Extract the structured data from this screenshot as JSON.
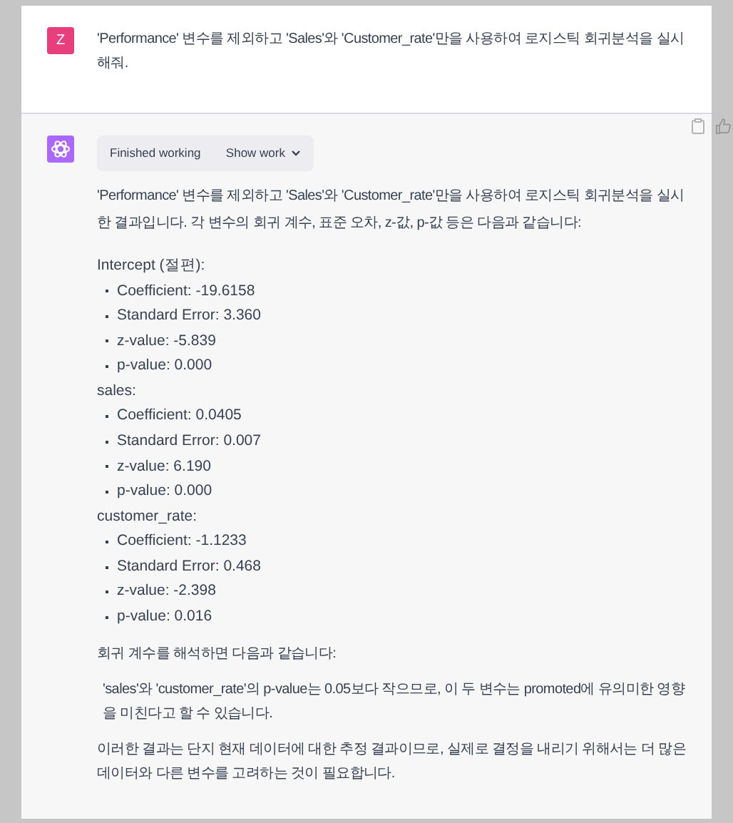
{
  "user_message": {
    "avatar": "Z",
    "text": "'Performance' 변수를 제외하고 'Sales'와 'Customer_rate'만을 사용하여 로지스틱 회귀분석을 실시해줘."
  },
  "assistant_message": {
    "status": "Finished working",
    "show_work": "Show work",
    "intro": "'Performance' 변수를 제외하고 'Sales'와 'Customer_rate'만을 사용하여 로지스틱 회귀분석을 실시한 결과입니다. 각 변수의 회귀 계수, 표준 오차, z-값, p-값 등은 다음과 같습니다:",
    "sections": [
      {
        "title": "Intercept (절편):",
        "items": [
          "Coefficient: -19.6158",
          "Standard Error: 3.360",
          "z-value: -5.839",
          "p-value: 0.000"
        ]
      },
      {
        "title": "sales:",
        "items": [
          "Coefficient: 0.0405",
          "Standard Error: 0.007",
          "z-value: 6.190",
          "p-value: 0.000"
        ]
      },
      {
        "title": "customer_rate:",
        "items": [
          "Coefficient: -1.1233",
          "Standard Error: 0.468",
          "z-value: -2.398",
          "p-value: 0.016"
        ]
      }
    ],
    "outro": [
      {
        "kind": "plain",
        "text": "회귀 계수를 해석하면 다음과 같습니다:"
      },
      {
        "kind": "indented",
        "text": "'sales'와 'customer_rate'의 p-value는 0.05보다 작으므로, 이 두 변수는 promoted에 유의미한 영향을 미친다고 할 수 있습니다."
      },
      {
        "kind": "plain",
        "text": "이러한 결과는 단지 현재 데이터에 대한 추정 결과이므로, 실제로 결정을 내리기 위해서는 더 많은 데이터와 다른 변수를 고려하는 것이 필요합니다."
      }
    ]
  }
}
